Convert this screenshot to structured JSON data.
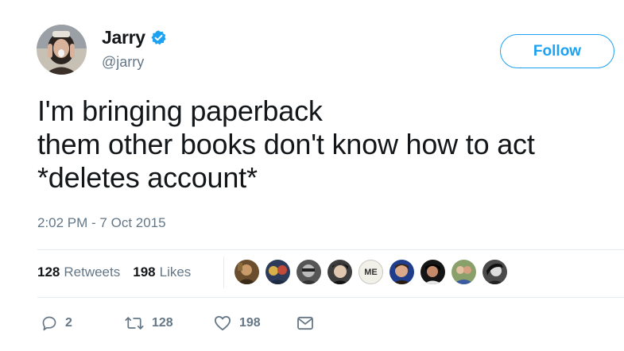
{
  "user": {
    "display_name": "Jarry",
    "handle": "@jarry",
    "verified_icon": "verified-badge-icon",
    "accent_color": "#1da1f2"
  },
  "follow_button": {
    "label": "Follow"
  },
  "tweet": {
    "lines": [
      "I'm bringing paperback",
      "them other books don't know how to act",
      "*deletes account*"
    ],
    "timestamp": "2:02 PM - 7 Oct 2015"
  },
  "stats": {
    "retweets_count": "128",
    "retweets_label": "Retweets",
    "likes_count": "198",
    "likes_label": "Likes"
  },
  "likers": {
    "me_label": "ME",
    "count_shown": 9
  },
  "actions": {
    "reply_count": "2",
    "retweet_count": "128",
    "like_count": "198"
  }
}
